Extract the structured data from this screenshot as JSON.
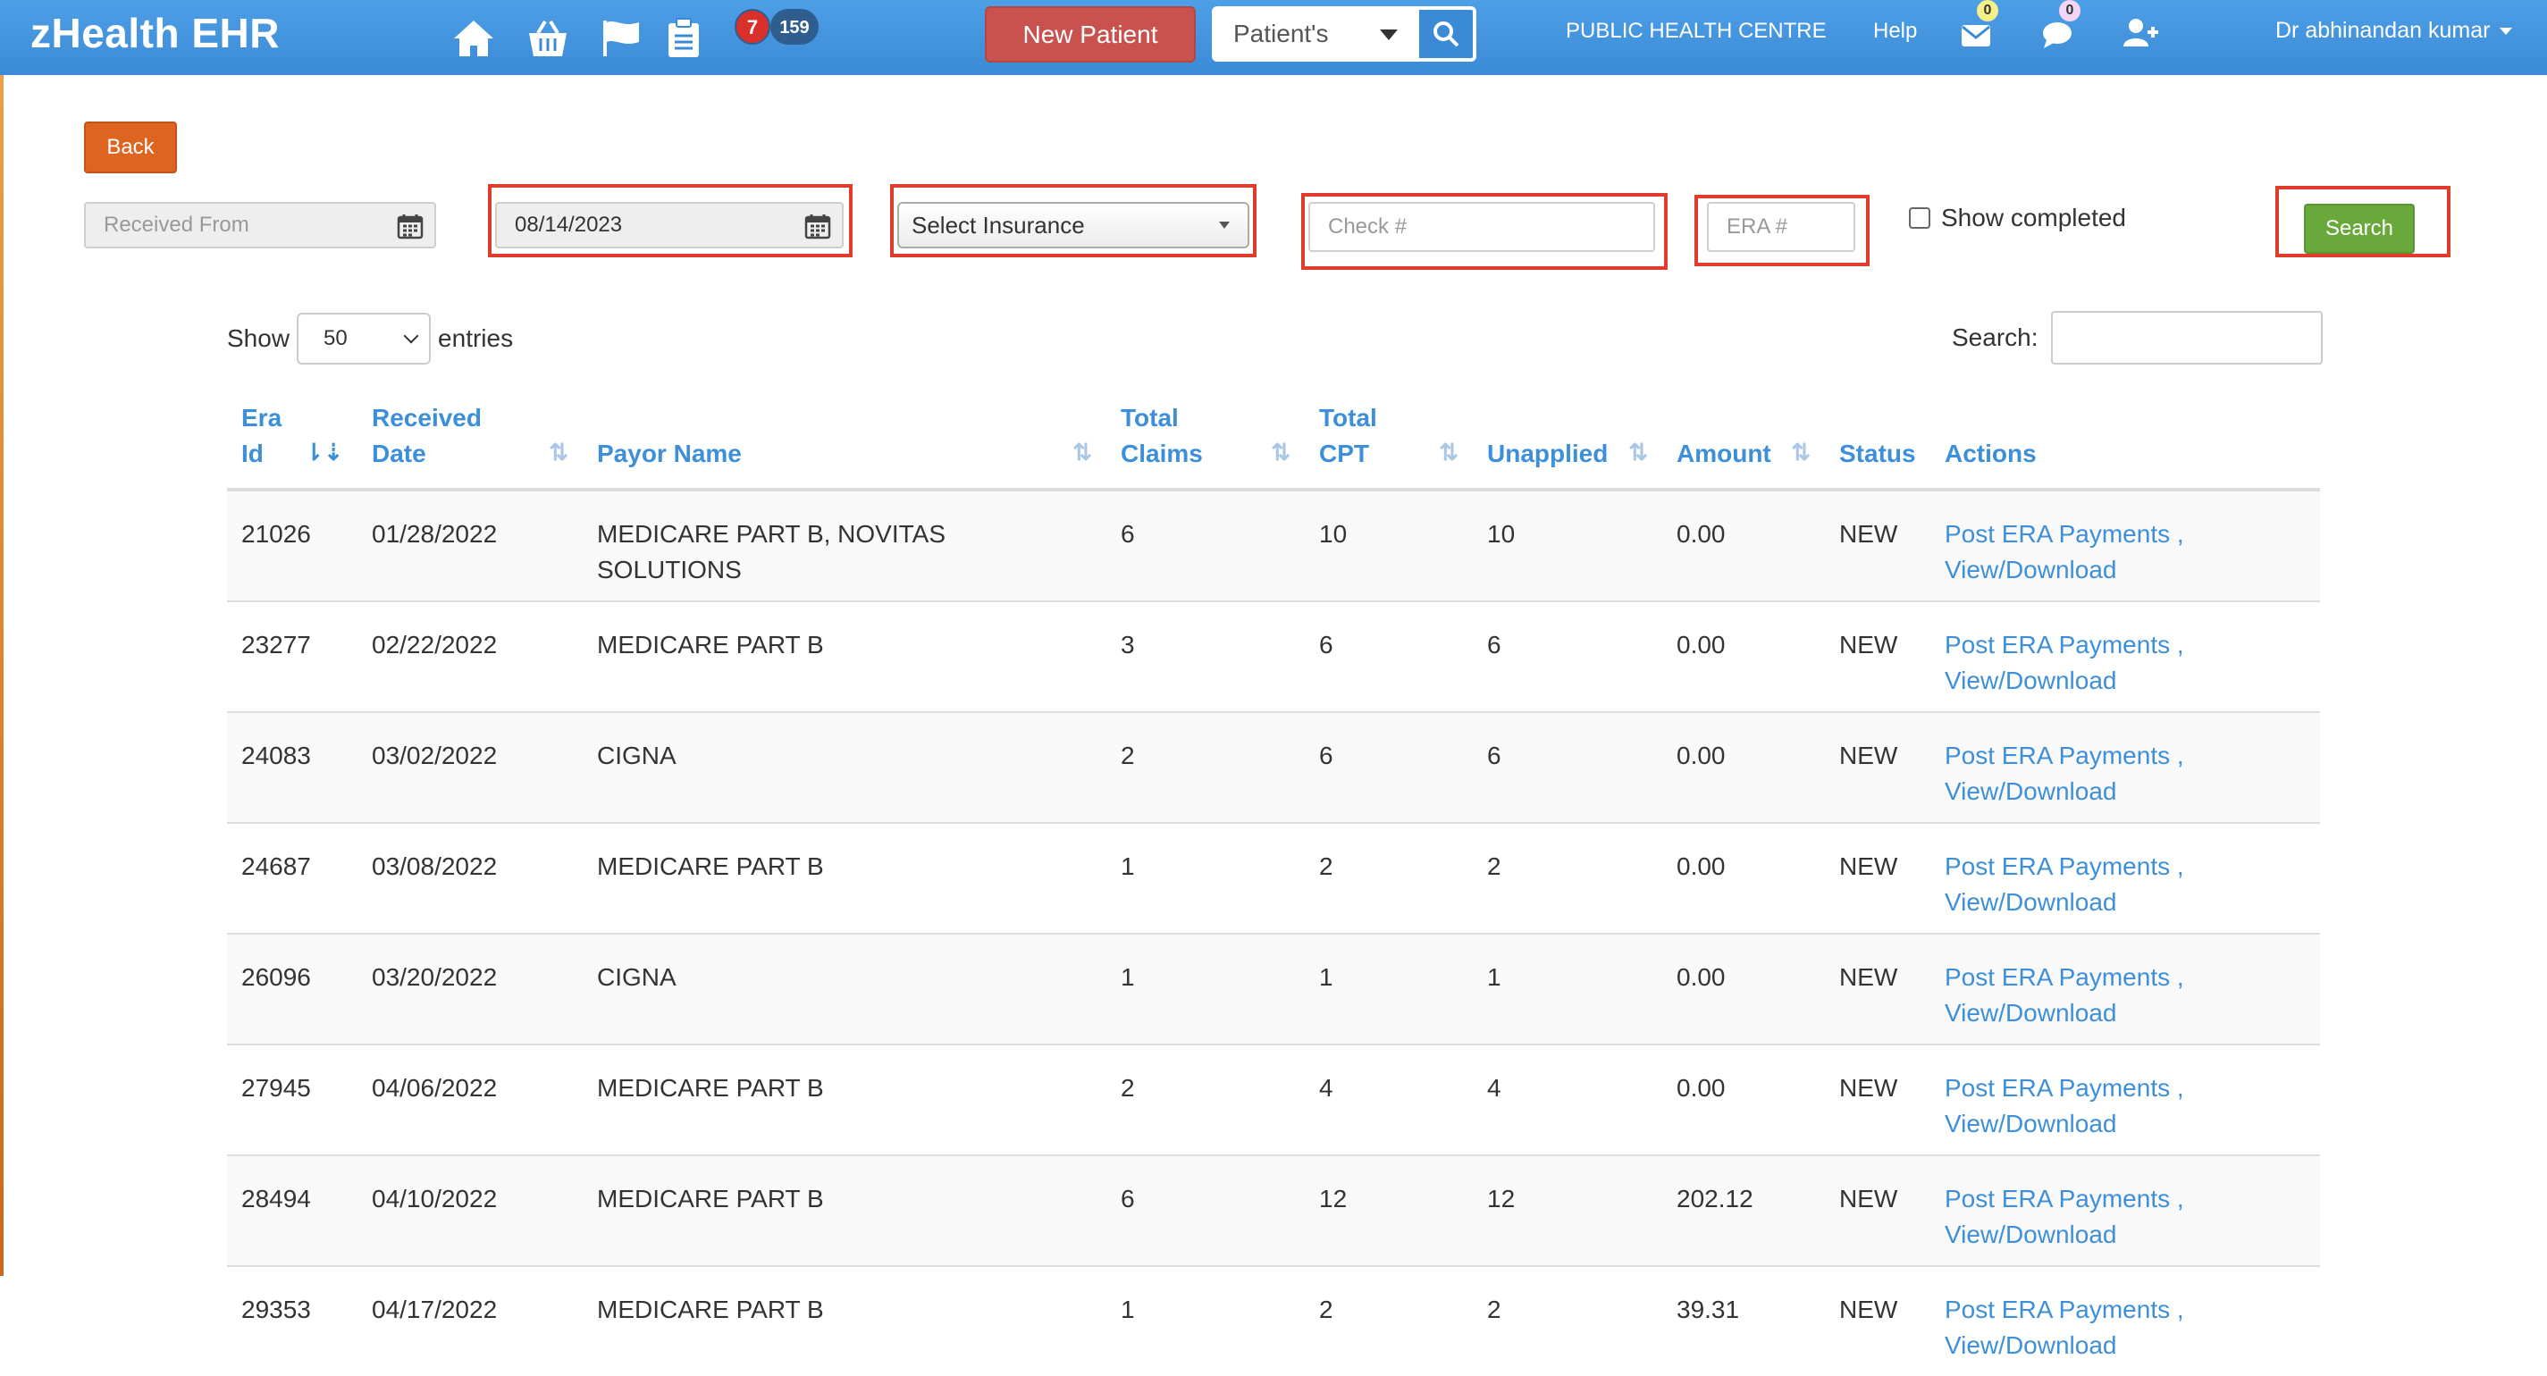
{
  "app": {
    "brand": "zHealth EHR",
    "badges": {
      "alerts": "7",
      "tasks": "159"
    },
    "new_patient": "New Patient",
    "patient_select": "Patient's",
    "centre": "PUBLIC HEALTH CENTRE",
    "help": "Help",
    "mail_count": "0",
    "chat_count": "0",
    "user": "Dr abhinandan kumar"
  },
  "filters": {
    "back": "Back",
    "received_from_placeholder": "Received From",
    "received_to_value": "08/14/2023",
    "insurance": "Select Insurance",
    "check_placeholder": "Check #",
    "era_placeholder": "ERA #",
    "show_completed": "Show completed",
    "search": "Search"
  },
  "table_controls": {
    "show": "Show",
    "entries_value": "50",
    "entries": "entries",
    "search_label": "Search:"
  },
  "table": {
    "headers": {
      "era_id": "Era Id",
      "received_date": "Received Date",
      "payor_name": "Payor Name",
      "total_claims": "Total Claims",
      "total_cpt": "Total CPT",
      "unapplied": "Unapplied",
      "amount": "Amount",
      "status": "Status",
      "actions": "Actions"
    },
    "rows": [
      {
        "era_id": "21026",
        "date": "01/28/2022",
        "payor": "MEDICARE PART B, NOVITAS SOLUTIONS",
        "claims": "6",
        "cpt": "10",
        "unapplied": "10",
        "amount": "0.00",
        "status": "NEW",
        "post": "Post ERA Payments ,",
        "view": "View/Download"
      },
      {
        "era_id": "23277",
        "date": "02/22/2022",
        "payor": "MEDICARE PART B",
        "claims": "3",
        "cpt": "6",
        "unapplied": "6",
        "amount": "0.00",
        "status": "NEW",
        "post": "Post ERA Payments ,",
        "view": "View/Download"
      },
      {
        "era_id": "24083",
        "date": "03/02/2022",
        "payor": "CIGNA",
        "claims": "2",
        "cpt": "6",
        "unapplied": "6",
        "amount": "0.00",
        "status": "NEW",
        "post": "Post ERA Payments ,",
        "view": "View/Download"
      },
      {
        "era_id": "24687",
        "date": "03/08/2022",
        "payor": "MEDICARE PART B",
        "claims": "1",
        "cpt": "2",
        "unapplied": "2",
        "amount": "0.00",
        "status": "NEW",
        "post": "Post ERA Payments ,",
        "view": "View/Download"
      },
      {
        "era_id": "26096",
        "date": "03/20/2022",
        "payor": "CIGNA",
        "claims": "1",
        "cpt": "1",
        "unapplied": "1",
        "amount": "0.00",
        "status": "NEW",
        "post": "Post ERA Payments ,",
        "view": "View/Download"
      },
      {
        "era_id": "27945",
        "date": "04/06/2022",
        "payor": "MEDICARE PART B",
        "claims": "2",
        "cpt": "4",
        "unapplied": "4",
        "amount": "0.00",
        "status": "NEW",
        "post": "Post ERA Payments ,",
        "view": "View/Download"
      },
      {
        "era_id": "28494",
        "date": "04/10/2022",
        "payor": "MEDICARE PART B",
        "claims": "6",
        "cpt": "12",
        "unapplied": "12",
        "amount": "202.12",
        "status": "NEW",
        "post": "Post ERA Payments ,",
        "view": "View/Download"
      },
      {
        "era_id": "29353",
        "date": "04/17/2022",
        "payor": "MEDICARE PART B",
        "claims": "1",
        "cpt": "2",
        "unapplied": "2",
        "amount": "39.31",
        "status": "NEW",
        "post": "Post ERA Payments ,",
        "view": "View/Download"
      }
    ]
  },
  "colors": {
    "navbar": "#3b8ad6",
    "new_patient": "#c9524f",
    "back": "#de6421",
    "search": "#69a83a",
    "highlight": "#e03b2c",
    "link": "#3d8fd9"
  },
  "icons": [
    "home-icon",
    "basket-icon",
    "flag-icon",
    "clipboard-icon",
    "search-icon",
    "mail-icon",
    "chat-icon",
    "add-user-icon",
    "calendar-icon",
    "sort-icon"
  ]
}
